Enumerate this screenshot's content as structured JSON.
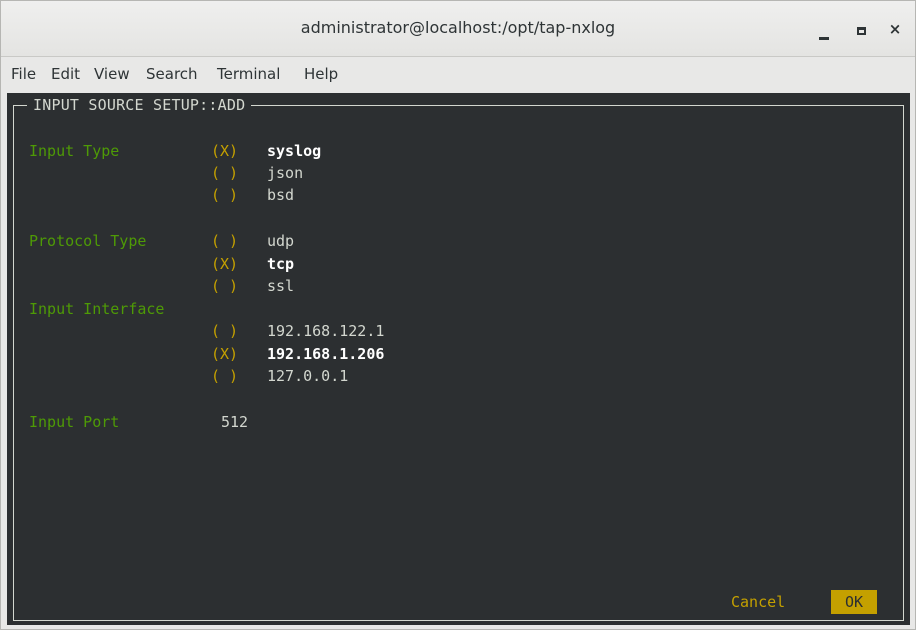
{
  "window": {
    "title": "administrator@localhost:/opt/tap-nxlog",
    "minimize": "_",
    "maximize": "□",
    "close": "×"
  },
  "menu": [
    "File",
    "Edit",
    "View",
    "Search",
    "Terminal",
    "Help"
  ],
  "dialog": {
    "title": "INPUT SOURCE SETUP::ADD",
    "sections": {
      "input_type": {
        "label": "Input Type",
        "options": [
          {
            "mark": "(X)",
            "text": "syslog",
            "selected": true
          },
          {
            "mark": "( )",
            "text": "json",
            "selected": false
          },
          {
            "mark": "( )",
            "text": "bsd",
            "selected": false
          }
        ]
      },
      "protocol_type": {
        "label": "Protocol Type",
        "options": [
          {
            "mark": "( )",
            "text": "udp",
            "selected": false
          },
          {
            "mark": "(X)",
            "text": "tcp",
            "selected": true
          },
          {
            "mark": "( )",
            "text": "ssl",
            "selected": false
          }
        ]
      },
      "input_interface": {
        "label": "Input Interface",
        "options": [
          {
            "mark": "( )",
            "text": "192.168.122.1",
            "selected": false
          },
          {
            "mark": "(X)",
            "text": "192.168.1.206",
            "selected": true
          },
          {
            "mark": "( )",
            "text": "127.0.0.1",
            "selected": false
          }
        ]
      },
      "input_port": {
        "label": "Input Port",
        "value": "512"
      }
    },
    "buttons": {
      "cancel": "Cancel",
      "ok": "OK"
    }
  },
  "colors": {
    "terminal_bg": "#2c2f31",
    "label_green": "#4e9a06",
    "accent_yellow": "#c4a000",
    "text_gray": "#d3d7cf"
  }
}
